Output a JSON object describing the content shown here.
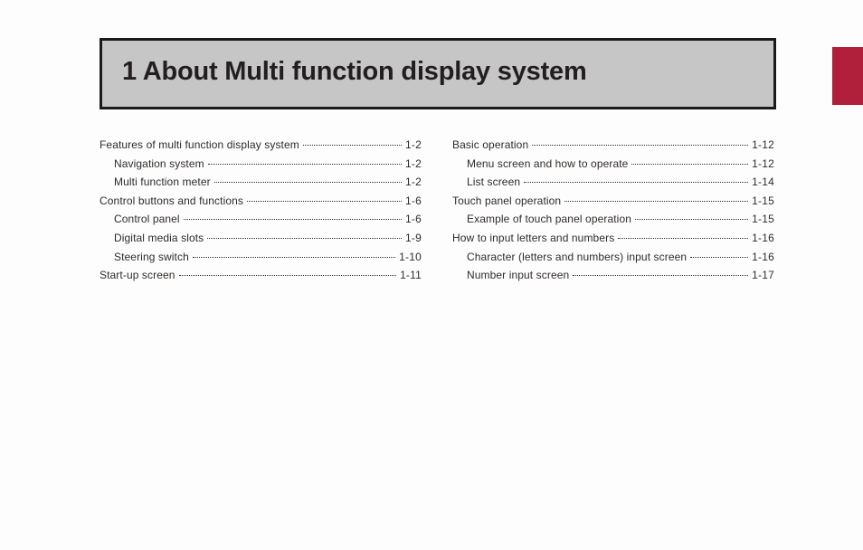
{
  "title": "1 About Multi function display system",
  "toc": {
    "left": [
      {
        "label": "Features of multi function display system",
        "page": "1-2",
        "indent": 0
      },
      {
        "label": "Navigation system",
        "page": "1-2",
        "indent": 1
      },
      {
        "label": "Multi function meter",
        "page": "1-2",
        "indent": 1
      },
      {
        "label": "Control buttons and functions",
        "page": "1-6",
        "indent": 0
      },
      {
        "label": "Control panel",
        "page": "1-6",
        "indent": 1
      },
      {
        "label": "Digital media slots",
        "page": "1-9",
        "indent": 1
      },
      {
        "label": "Steering switch",
        "page": "1-10",
        "indent": 1
      },
      {
        "label": "Start-up screen",
        "page": "1-11",
        "indent": 0
      }
    ],
    "right": [
      {
        "label": "Basic operation",
        "page": "1-12",
        "indent": 0
      },
      {
        "label": "Menu screen and how to operate",
        "page": "1-12",
        "indent": 1
      },
      {
        "label": "List screen",
        "page": "1-14",
        "indent": 1
      },
      {
        "label": "Touch panel operation",
        "page": "1-15",
        "indent": 0
      },
      {
        "label": "Example of touch panel operation",
        "page": "1-15",
        "indent": 1
      },
      {
        "label": "How to input letters and numbers",
        "page": "1-16",
        "indent": 0
      },
      {
        "label": "Character (letters and numbers) input screen",
        "page": "1-16",
        "indent": 1
      },
      {
        "label": "Number input screen",
        "page": "1-17",
        "indent": 1
      }
    ]
  }
}
